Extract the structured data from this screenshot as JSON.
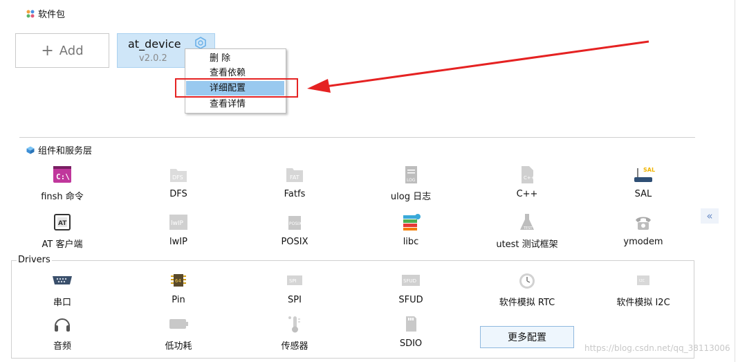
{
  "packages_section": {
    "title": "软件包"
  },
  "add_card": {
    "label": "Add",
    "plus": "+"
  },
  "package": {
    "name": "at_device",
    "version": "v2.0.2"
  },
  "context_menu": {
    "items": [
      "删 除",
      "查看依赖",
      "详细配置",
      "查看详情"
    ],
    "selected_index": 2
  },
  "components_section": {
    "title": "组件和服务层",
    "items": [
      {
        "label": "finsh 命令",
        "icon": "terminal-icon"
      },
      {
        "label": "DFS",
        "icon": "folder-icon"
      },
      {
        "label": "Fatfs",
        "icon": "fat-folder-icon"
      },
      {
        "label": "ulog 日志",
        "icon": "log-file-icon"
      },
      {
        "label": "C++",
        "icon": "cpp-file-icon"
      },
      {
        "label": "SAL",
        "icon": "router-icon"
      },
      {
        "label": "AT 客户端",
        "icon": "at-icon"
      },
      {
        "label": "lwIP",
        "icon": "lwip-icon"
      },
      {
        "label": "POSIX",
        "icon": "posix-icon"
      },
      {
        "label": "libc",
        "icon": "books-icon"
      },
      {
        "label": "utest 测试框架",
        "icon": "flask-icon"
      },
      {
        "label": "ymodem",
        "icon": "telephone-icon"
      }
    ]
  },
  "drivers_section": {
    "title": "Drivers",
    "items": [
      {
        "label": "串口",
        "icon": "serial-port-icon"
      },
      {
        "label": "Pin",
        "icon": "chip-icon"
      },
      {
        "label": "SPI",
        "icon": "spi-icon"
      },
      {
        "label": "SFUD",
        "icon": "sfud-icon"
      },
      {
        "label": "软件模拟 RTC",
        "icon": "alarm-clock-icon"
      },
      {
        "label": "软件模拟 I2C",
        "icon": "i2c-icon"
      },
      {
        "label": "音频",
        "icon": "headphones-icon"
      },
      {
        "label": "低功耗",
        "icon": "battery-icon"
      },
      {
        "label": "传感器",
        "icon": "thermometer-icon"
      },
      {
        "label": "SDIO",
        "icon": "sd-card-icon"
      }
    ],
    "more_button": "更多配置"
  },
  "collapse_button": "«",
  "watermark": "https://blog.csdn.net/qq_38113006",
  "colors": {
    "selection": "#99c9ef",
    "package_card": "#cfe6f8",
    "annotation_red": "#e52222"
  }
}
